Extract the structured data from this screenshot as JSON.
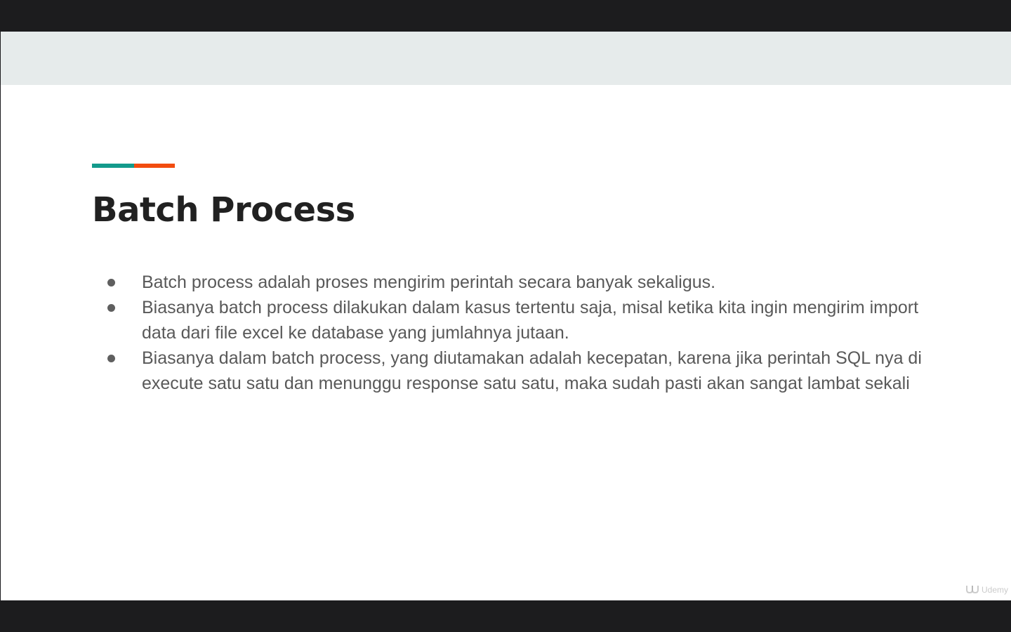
{
  "slide": {
    "title": "Batch Process",
    "accent_colors": {
      "left": "#139a8c",
      "right": "#f24c0f"
    },
    "bullets": [
      "Batch process adalah proses mengirim perintah secara banyak sekaligus.",
      "Biasanya batch process dilakukan dalam kasus tertentu saja, misal ketika kita ingin mengirim import data dari file excel ke database yang jumlahnya jutaan.",
      "Biasanya dalam batch process, yang diutamakan adalah kecepatan, karena jika perintah SQL nya di execute satu satu dan menunggu response satu satu, maka sudah pasti akan sangat lambat sekali"
    ]
  },
  "watermark": {
    "brand": "Udemy",
    "icon": "udemy-logo-icon"
  }
}
